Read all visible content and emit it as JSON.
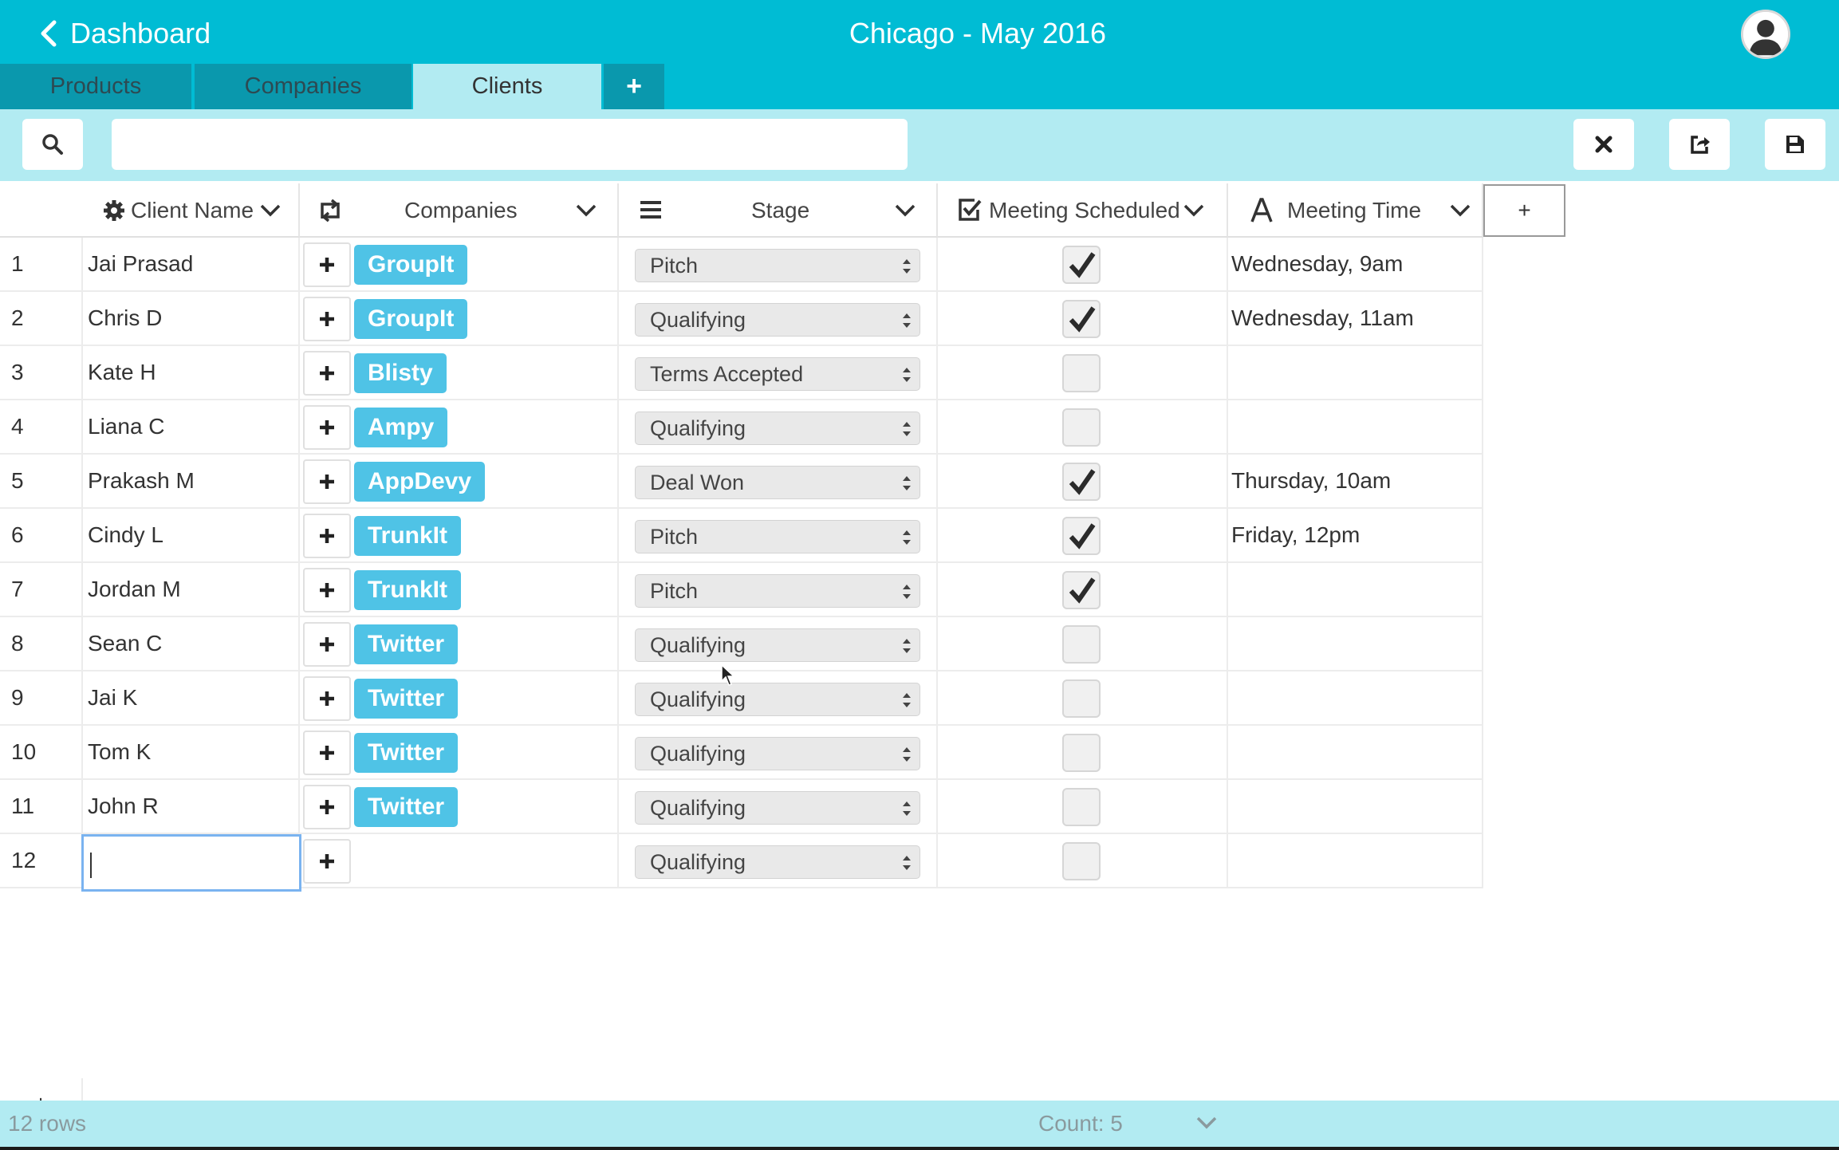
{
  "header": {
    "back_label": "Dashboard",
    "title": "Chicago - May 2016"
  },
  "tabs": [
    {
      "label": "Products",
      "active": false
    },
    {
      "label": "Companies",
      "active": false
    },
    {
      "label": "Clients",
      "active": true
    }
  ],
  "tab_add_label": "+",
  "toolbar": {
    "search_value": "",
    "search_placeholder": "",
    "icons": [
      "search-icon",
      "close-icon",
      "share-icon",
      "save-icon"
    ]
  },
  "columns": [
    {
      "label": "Client Name",
      "icon": "gear-icon"
    },
    {
      "label": "Companies",
      "icon": "linked-records-icon"
    },
    {
      "label": "Stage",
      "icon": "list-icon"
    },
    {
      "label": "Meeting Scheduled",
      "icon": "checkbox-icon"
    },
    {
      "label": "Meeting Time",
      "icon": "text-icon"
    }
  ],
  "add_column_label": "+",
  "rows": [
    {
      "num": "1",
      "name": "Jai Prasad",
      "company": "GroupIt",
      "stage": "Pitch",
      "meeting": true,
      "time": "Wednesday, 9am"
    },
    {
      "num": "2",
      "name": "Chris D",
      "company": "GroupIt",
      "stage": "Qualifying",
      "meeting": true,
      "time": "Wednesday, 11am"
    },
    {
      "num": "3",
      "name": "Kate H",
      "company": "Blisty",
      "stage": "Terms Accepted",
      "meeting": false,
      "time": ""
    },
    {
      "num": "4",
      "name": "Liana C",
      "company": "Ampy",
      "stage": "Qualifying",
      "meeting": false,
      "time": ""
    },
    {
      "num": "5",
      "name": "Prakash M",
      "company": "AppDevy",
      "stage": "Deal Won",
      "meeting": true,
      "time": "Thursday, 10am"
    },
    {
      "num": "6",
      "name": "Cindy L",
      "company": "TrunkIt",
      "stage": "Pitch",
      "meeting": true,
      "time": "Friday, 12pm"
    },
    {
      "num": "7",
      "name": "Jordan M",
      "company": "TrunkIt",
      "stage": "Pitch",
      "meeting": true,
      "time": ""
    },
    {
      "num": "8",
      "name": "Sean C",
      "company": "Twitter",
      "stage": "Qualifying",
      "meeting": false,
      "time": ""
    },
    {
      "num": "9",
      "name": "Jai K",
      "company": "Twitter",
      "stage": "Qualifying",
      "meeting": false,
      "time": ""
    },
    {
      "num": "10",
      "name": "Tom K",
      "company": "Twitter",
      "stage": "Qualifying",
      "meeting": false,
      "time": ""
    },
    {
      "num": "11",
      "name": "John R",
      "company": "Twitter",
      "stage": "Qualifying",
      "meeting": false,
      "time": ""
    },
    {
      "num": "12",
      "name": "",
      "company": "",
      "stage": "Qualifying",
      "meeting": false,
      "time": "",
      "editing": true
    }
  ],
  "add_row_label": "+",
  "footer": {
    "rows_label": "12 rows",
    "count_label": "Count: 5"
  },
  "colors": {
    "topbar": "#00bcd4",
    "tab_dark": "#0a98ad",
    "tab_active": "#b2ebf2",
    "chip": "#4fc3e6"
  }
}
